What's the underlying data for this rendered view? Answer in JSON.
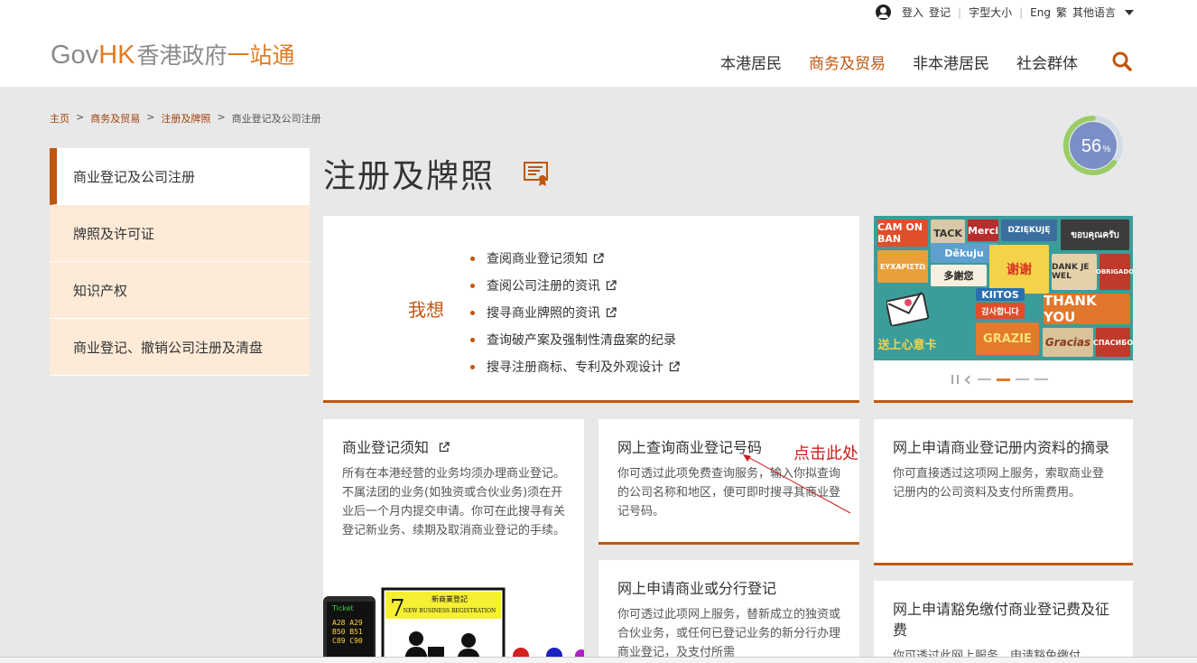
{
  "util": {
    "login": "登入",
    "register": "登记",
    "font_size": "字型大小",
    "eng": "Eng",
    "trad": "繁",
    "other_lang": "其他语言"
  },
  "logo": {
    "gov": "Gov",
    "hk": "HK",
    "cn1": "香港政府",
    "cn2": "一站通"
  },
  "nav": {
    "residents": "本港居民",
    "business": "商务及贸易",
    "non_residents": "非本港居民",
    "community": "社会群体"
  },
  "breadcrumb": {
    "home": "主页",
    "business": "商务及贸易",
    "registration": "注册及牌照",
    "current": "商业登记及公司注册",
    "sep": ">"
  },
  "progress": {
    "value": "56",
    "unit": "%"
  },
  "sidebar": {
    "items": [
      {
        "label": "商业登记及公司注册"
      },
      {
        "label": "牌照及许可证"
      },
      {
        "label": "知识产权"
      },
      {
        "label": "商业登记、撤销公司注册及清盘"
      }
    ]
  },
  "page_title": "注册及牌照",
  "iwant": {
    "label": "我想",
    "items": [
      "查阅商业登记须知",
      "查阅公司注册的资讯",
      "搜寻商业牌照的资讯",
      "查询破产案及强制性清盘案的纪录",
      "搜寻注册商标、专利及外观设计"
    ]
  },
  "banner": {
    "tiles": [
      "CAM ON BAN",
      "TACK",
      "Merci",
      "DZIĘKUJĘ",
      "ขอบคุณครับ",
      "ΕΥΧΑΡΙΣΤΩ",
      "Děkuju",
      "多謝您",
      "谢谢",
      "DANK JE WEL",
      "OBRIGADO",
      "KIITOS",
      "감사합니다",
      "THANK YOU",
      "GRAZIE",
      "Gracias",
      "СПАСИБО",
      "送上心意卡"
    ]
  },
  "cards": [
    {
      "title": "商业登记须知",
      "desc": "所有在本港经营的业务均须办理商业登记。不属法团的业务(如独资或合伙业务)须在开业后一个月内提交申请。你可在此搜寻有关登记新业务、续期及取消商业登记的手续。"
    },
    {
      "title": "网上查询商业登记号码",
      "desc": "你可透过此项免费查询服务，输入你拟查询的公司名称和地区，便可即时搜寻其商业登记号码。"
    },
    {
      "title": "网上申请商业登记册内资料的摘录",
      "desc": "你可直接透过这项网上服务，索取商业登记册内的公司资料及支付所需费用。"
    },
    {
      "title": "网上申请商业或分行登记",
      "desc": "你可透过此项网上服务，替新成立的独资或合伙业务，或任何已登记业务的新分行办理商业登记，及支付所需"
    },
    {
      "title": "网上申请豁免缴付商业登记费及征费",
      "desc": "你可透过此网上服务，申请豁免缴付"
    }
  ],
  "illustration": {
    "ticket": "Ticket",
    "numbers": "A28 A29\nB50 B51\nC89 C90",
    "queue_no": "7",
    "sign_cn": "新商業登記",
    "sign_en": "NEW BUSINESS REGISTRATION"
  },
  "annotation": "点击此处",
  "colors": {
    "accent": "#c0560f",
    "orange": "#e07b22",
    "sidebar_bg": "#fdebd8"
  }
}
